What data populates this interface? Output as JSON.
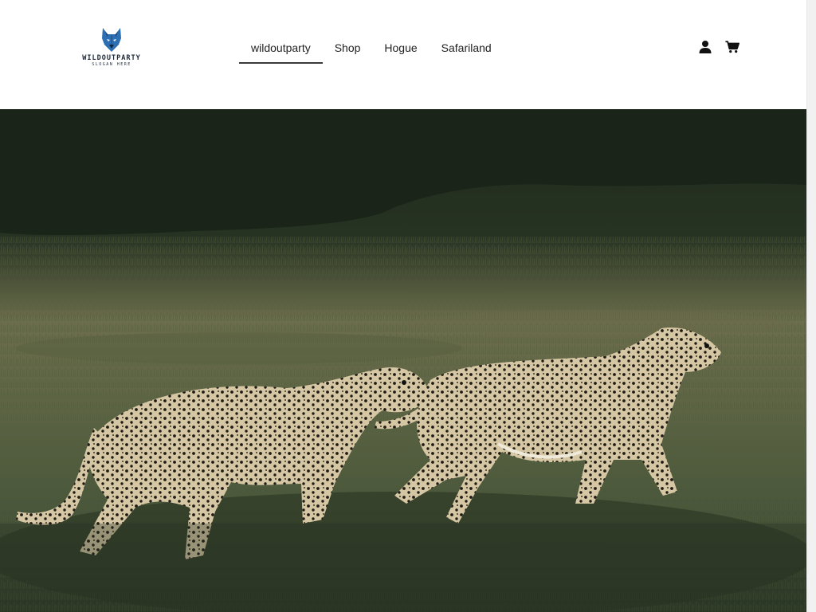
{
  "brand": {
    "name": "WILDOUTPARTY",
    "slogan": "SLOGAN HERE",
    "logo_icon": "wolf-head-icon",
    "color": "#1d2838",
    "accent": "#2d6fb3"
  },
  "nav": {
    "items": [
      {
        "label": "wildoutparty",
        "active": true
      },
      {
        "label": "Shop",
        "active": false
      },
      {
        "label": "Hogue",
        "active": false
      },
      {
        "label": "Safariland",
        "active": false
      }
    ]
  },
  "header_icons": {
    "account": "user-icon",
    "cart": "shopping-cart-icon"
  },
  "hero": {
    "subject": "two-cheetahs-walking-in-grass"
  }
}
